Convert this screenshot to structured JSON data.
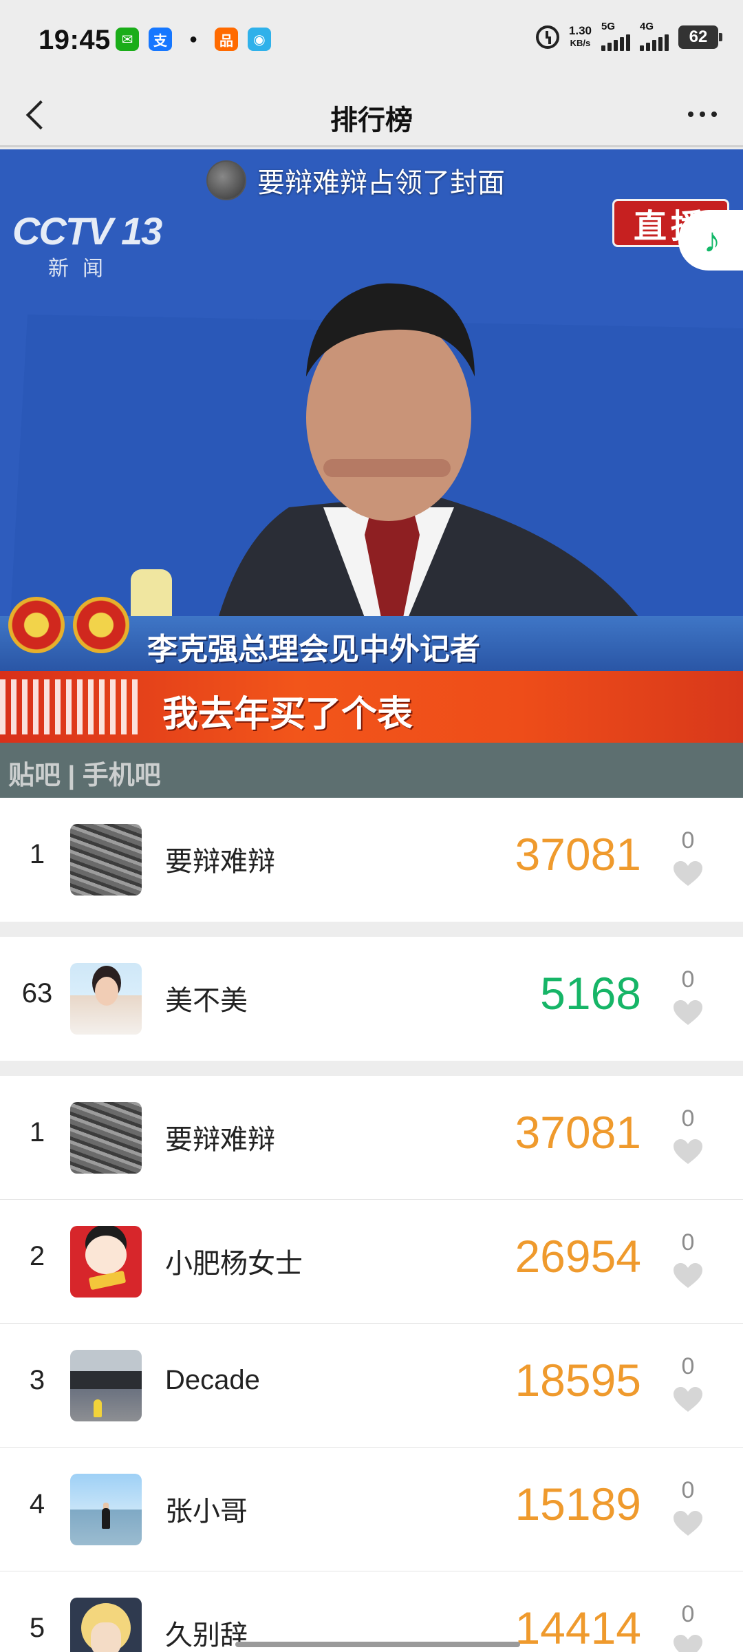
{
  "status_bar": {
    "time": "19:45",
    "apps": [
      {
        "name": "wechat-icon",
        "color": "#1aad19",
        "glyph": "✉"
      },
      {
        "name": "alipay-icon",
        "color": "#1677ff",
        "glyph": "支"
      },
      {
        "name": "qq-icon",
        "color": "#ffffff",
        "glyph": "🐧"
      },
      {
        "name": "app-orange-icon",
        "color": "#ff6a00",
        "glyph": "品"
      },
      {
        "name": "wifi-app-icon",
        "color": "#2fb1ea",
        "glyph": "◉"
      }
    ],
    "net_speed_value": "1.30",
    "net_speed_unit": "KB/s",
    "signal1_label": "5G",
    "signal2_label": "4G",
    "battery": "62"
  },
  "navbar": {
    "title": "排行榜"
  },
  "banner": {
    "cover_text": "要辩难辩占领了封面",
    "channel_logo": "CCTV 13",
    "channel_sub": "新闻",
    "live_badge": "直播",
    "ticker_headline": "李克强总理会见中外记者",
    "ticker_caption": "我去年买了个表",
    "watermark": "贴吧 | 手机吧"
  },
  "colors": {
    "score_orange": "#ef9a2d",
    "score_green": "#16b567",
    "music_green": "#12b868"
  },
  "entries": [
    {
      "rank": "1",
      "name": "要辩难辩",
      "score": "37081",
      "likes": "0",
      "avatar": "av-blur",
      "score_color": "orange",
      "group_end": true
    },
    {
      "rank": "63",
      "name": "美不美",
      "score": "5168",
      "likes": "0",
      "avatar": "av-selfie",
      "score_color": "green",
      "group_end": true
    },
    {
      "rank": "1",
      "name": "要辩难辩",
      "score": "37081",
      "likes": "0",
      "avatar": "av-blur",
      "score_color": "orange",
      "group_end": false
    },
    {
      "rank": "2",
      "name": "小肥杨女士",
      "score": "26954",
      "likes": "0",
      "avatar": "av-girl",
      "score_color": "orange",
      "group_end": false
    },
    {
      "rank": "3",
      "name": "Decade",
      "score": "18595",
      "likes": "0",
      "avatar": "av-car",
      "score_color": "orange",
      "group_end": false
    },
    {
      "rank": "4",
      "name": "张小哥",
      "score": "15189",
      "likes": "0",
      "avatar": "av-sea",
      "score_color": "orange",
      "group_end": false
    },
    {
      "rank": "5",
      "name": "久别辞",
      "score": "14414",
      "likes": "0",
      "avatar": "av-anime",
      "score_color": "orange",
      "group_end": false
    }
  ]
}
